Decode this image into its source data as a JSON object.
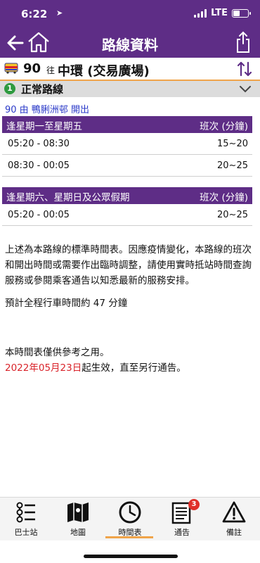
{
  "status": {
    "time": "6:22",
    "carrier": "LTE"
  },
  "nav": {
    "title": "路線資料"
  },
  "route": {
    "number": "90",
    "to_label": "往",
    "destination": "中環 (交易廣場)"
  },
  "variant": {
    "badge": "1",
    "label": "正常路線"
  },
  "departure_note": "90 由 鴨脷洲邨 開出",
  "timetables": [
    {
      "header": "逢星期一至星期五",
      "col_header": "班次 (分鐘)",
      "rows": [
        {
          "time": "05:20 - 08:30",
          "freq": "15~20"
        },
        {
          "time": "08:30 - 00:05",
          "freq": "20~25"
        }
      ]
    },
    {
      "header": "逢星期六、星期日及公眾假期",
      "col_header": "班次 (分鐘)",
      "rows": [
        {
          "time": "05:20 - 00:05",
          "freq": "20~25"
        }
      ]
    }
  ],
  "notes": {
    "p1": "上述為本路線的標準時間表。因應疫情變化，本路線的班次和開出時間或需要作出臨時調整，請使用實時抵站時間查詢服務或參閱乘客通告以知悉最新的服務安排。",
    "p2": "預計全程行車時間約 47 分鐘",
    "p3": "本時間表僅供參考之用。",
    "effective_date": "2022年05月23日",
    "effective_suffix": "起生效，直至另行通告。"
  },
  "tabs": [
    {
      "label": "巴士站",
      "icon": "bus-stop-list-icon"
    },
    {
      "label": "地圖",
      "icon": "map-icon"
    },
    {
      "label": "時間表",
      "icon": "clock-icon",
      "active": true
    },
    {
      "label": "通告",
      "icon": "notice-icon",
      "badge": "3"
    },
    {
      "label": "備註",
      "icon": "warning-icon"
    }
  ],
  "colors": {
    "brand": "#5e2d86",
    "accent": "#f0a44a",
    "link": "#2a39c8",
    "alert": "#d9232a"
  }
}
